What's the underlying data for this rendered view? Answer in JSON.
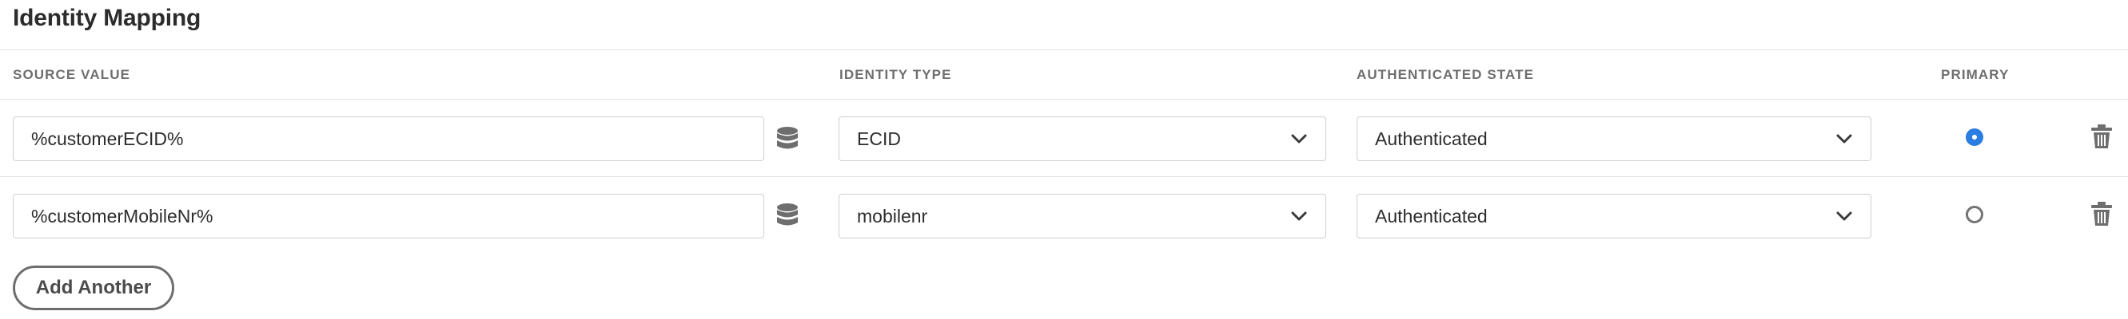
{
  "section": {
    "title": "Identity Mapping"
  },
  "columns": {
    "source_value": "SOURCE VALUE",
    "identity_type": "IDENTITY TYPE",
    "authenticated_state": "AUTHENTICATED STATE",
    "primary": "PRIMARY"
  },
  "rows": [
    {
      "source_value": "%customerECID%",
      "identity_type": "ECID",
      "authenticated_state": "Authenticated",
      "primary": true
    },
    {
      "source_value": "%customerMobileNr%",
      "identity_type": "mobilenr",
      "authenticated_state": "Authenticated",
      "primary": false
    }
  ],
  "actions": {
    "add_another": "Add Another"
  },
  "icons": {
    "data_element": "database-icon",
    "dropdown": "chevron-down-icon",
    "delete": "trash-icon"
  },
  "colors": {
    "accent": "#2b7de1",
    "text": "#2c2c2c",
    "muted": "#6e6e6e",
    "border": "#cfcfcf",
    "icon": "#6e6e6e"
  }
}
